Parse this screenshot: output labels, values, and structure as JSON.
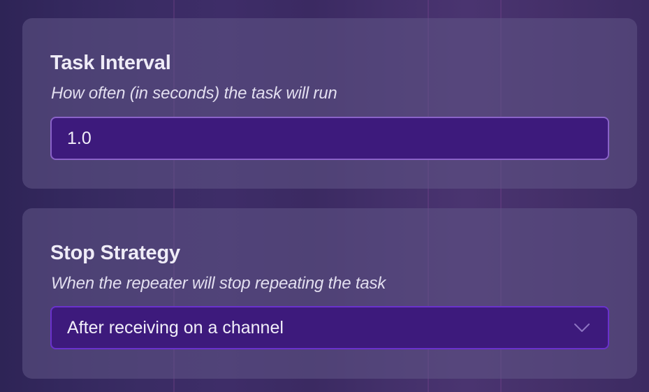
{
  "task_interval": {
    "title": "Task Interval",
    "description": "How often (in seconds) the task will run",
    "value": "1.0"
  },
  "stop_strategy": {
    "title": "Stop Strategy",
    "description": "When the repeater will stop repeating the task",
    "selected": "After receiving on a channel",
    "icon": "chevron-down-icon"
  },
  "colors": {
    "card": "#605686",
    "input_background": "#3d1a7c",
    "input_border": "#8a63c8",
    "select_border": "#6a32cc"
  }
}
